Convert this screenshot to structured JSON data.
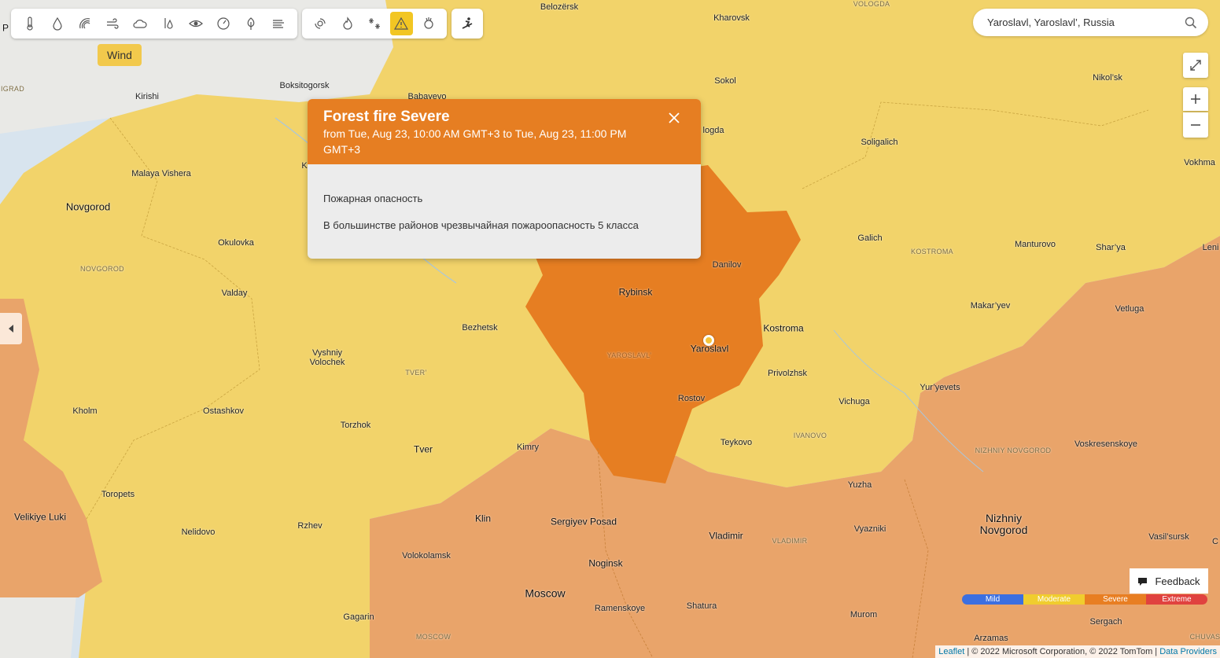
{
  "toolbar": {
    "items": [
      {
        "icon": "thermometer-icon"
      },
      {
        "icon": "droplet-icon"
      },
      {
        "icon": "radar-icon"
      },
      {
        "icon": "wind-icon"
      },
      {
        "icon": "cloud-icon"
      },
      {
        "icon": "humidity-icon"
      },
      {
        "icon": "eye-icon"
      },
      {
        "icon": "pressure-gauge-icon"
      },
      {
        "icon": "pollen-leaf-icon"
      },
      {
        "icon": "air-quality-icon"
      }
    ],
    "group2": [
      {
        "icon": "hurricane-icon"
      },
      {
        "icon": "fire-icon"
      },
      {
        "icon": "snowflakes-icon"
      },
      {
        "icon": "warning-icon",
        "active": true
      },
      {
        "icon": "earthquake-icon"
      }
    ],
    "ski_icon": "skier-icon",
    "tooltip": "Wind"
  },
  "search": {
    "value": "Yaroslavl, Yaroslavl’, Russia"
  },
  "popup": {
    "title": "Forest fire Severe",
    "time": "from Tue, Aug 23, 10:00 AM GMT+3 to Tue, Aug 23, 11:00 PM GMT+3",
    "line1": "Пожарная опасность",
    "line2": "В большинстве районов чрезвычайная пожароопасность 5 класса"
  },
  "colors": {
    "mild": "#3c6fe0",
    "moderate": "#f0cd2e",
    "severe": "#e87e22",
    "extreme": "#e0423f",
    "map_moderate": "#f2d36a",
    "map_severe_light": "#e9a46a",
    "map_severe": "#e67e22"
  },
  "legend": {
    "mild": "Mild",
    "moderate": "Moderate",
    "severe": "Severe",
    "extreme": "Extreme"
  },
  "feedback": "Feedback",
  "attribution": {
    "leaflet": "Leaflet",
    "text": " | © 2022 Microsoft Corporation, © 2022 TomTom | ",
    "providers": "Data Providers"
  },
  "places": {
    "belozersk": "Belozërsk",
    "kharovsk": "Kharovsk",
    "vologda_region": "VOLOGDA",
    "boksitogorsk": "Boksitogorsk",
    "babayevo": "Babayevo",
    "kirishi": "Kirishi",
    "sokol": "Sokol",
    "nikolsk": "Nikol’sk",
    "vologda": "logda",
    "soligalich": "Soligalich",
    "vokhma": "Vokhma",
    "malaya_vishera": "Malaya Vishera",
    "novgorod": "Novgorod",
    "okulovka": "Okulovka",
    "novgorod_region": "NOVGOROD",
    "galich": "Galich",
    "kostroma_region": "KOSTROMA",
    "manturovo": "Manturovo",
    "sharya": "Shar’ya",
    "leni": "Leni",
    "danilov": "Danilov",
    "valday": "Valday",
    "rybinsk": "Rybinsk",
    "makaryev": "Makar’yev",
    "vetluga": "Vetluga",
    "bezhetsk": "Bezhetsk",
    "kostroma": "Kostroma",
    "yaroslavl": "Yaroslavl",
    "yaroslavl_region": "YAROSLAVL’",
    "vyshniy": "Vyshniy\nVolochek",
    "tver_region": "TVER’",
    "privolzhsk": "Privolzhsk",
    "yuryevets": "Yur’yevets",
    "kholm": "Kholm",
    "ostashkov": "Ostashkov",
    "rostov": "Rostov",
    "vichuga": "Vichuga",
    "torzhok": "Torzhok",
    "ivanovo_region": "IVANOVO",
    "teykovo": "Teykovo",
    "nizhniy_region": "NIZHNIY NOVGOROD",
    "voskresenskoye": "Voskresenskoye",
    "tver": "Tver",
    "kimry": "Kimry",
    "toropets": "Toropets",
    "yuzha": "Yuzha",
    "velikiye_luki": "Velikiye Luki",
    "klin": "Klin",
    "sergiyev_posad": "Sergiyev Posad",
    "rzhev": "Rzhev",
    "nizhniy": "Nizhniy\nNovgorod",
    "nelidovo": "Nelidovo",
    "vladimir": "Vladimir",
    "vladimir_region": "VLADIMIR",
    "vyazniki": "Vyazniki",
    "vasilsursk": "Vasil’sursk",
    "volokolamsk": "Volokolamsk",
    "noginsk": "Noginsk",
    "moscow": "Moscow",
    "ramenskoye": "Ramenskoye",
    "shatura": "Shatura",
    "murom": "Murom",
    "sergach": "Sergach",
    "gagarin": "Gagarin",
    "moscow_region": "MOSCOW",
    "arzamas": "Arzamas",
    "chuvash": "CHUVAS",
    "igrad": "IGRAD",
    "k": "K",
    "p": "P",
    "c": "C"
  }
}
